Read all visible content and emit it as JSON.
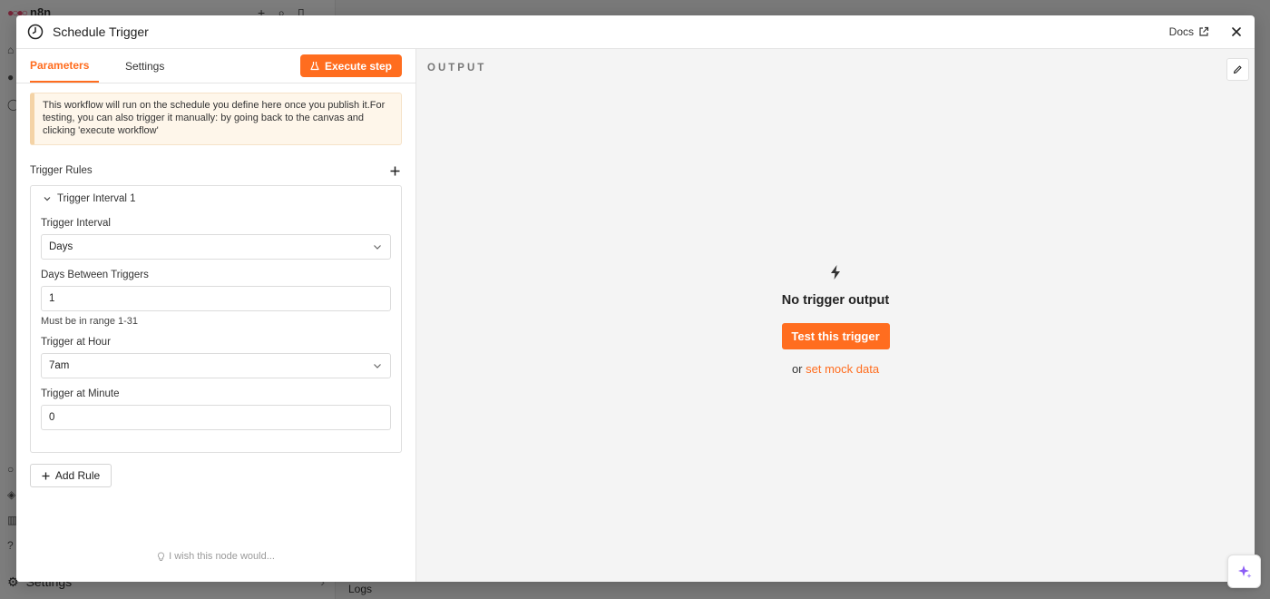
{
  "background": {
    "logo": "n8n",
    "settings_label": "Settings",
    "logs_label": "Logs"
  },
  "modal": {
    "title": "Schedule Trigger",
    "docs_label": "Docs",
    "tabs": [
      {
        "label": "Parameters",
        "active": true
      },
      {
        "label": "Settings",
        "active": false
      }
    ],
    "execute_label": "Execute step",
    "notice": "This workflow will run on the schedule you define here once you publish it.For testing, you can also trigger it manually: by going back to the canvas and clicking 'execute workflow'",
    "trigger_rules_label": "Trigger Rules",
    "rule": {
      "title": "Trigger Interval 1",
      "interval_label": "Trigger Interval",
      "interval_value": "Days",
      "days_label": "Days Between Triggers",
      "days_value": "1",
      "days_hint": "Must be in range 1-31",
      "hour_label": "Trigger at Hour",
      "hour_value": "7am",
      "minute_label": "Trigger at Minute",
      "minute_value": "0"
    },
    "add_rule_label": "Add Rule",
    "wish_label": "I wish this node would..."
  },
  "output": {
    "label": "OUTPUT",
    "empty_title": "No trigger output",
    "test_button": "Test this trigger",
    "or_text": "or",
    "mock_link": "set mock data"
  },
  "colors": {
    "accent": "#ff6d1f",
    "notice_bg": "#fef6ea",
    "notice_border": "#f4d3a6"
  }
}
